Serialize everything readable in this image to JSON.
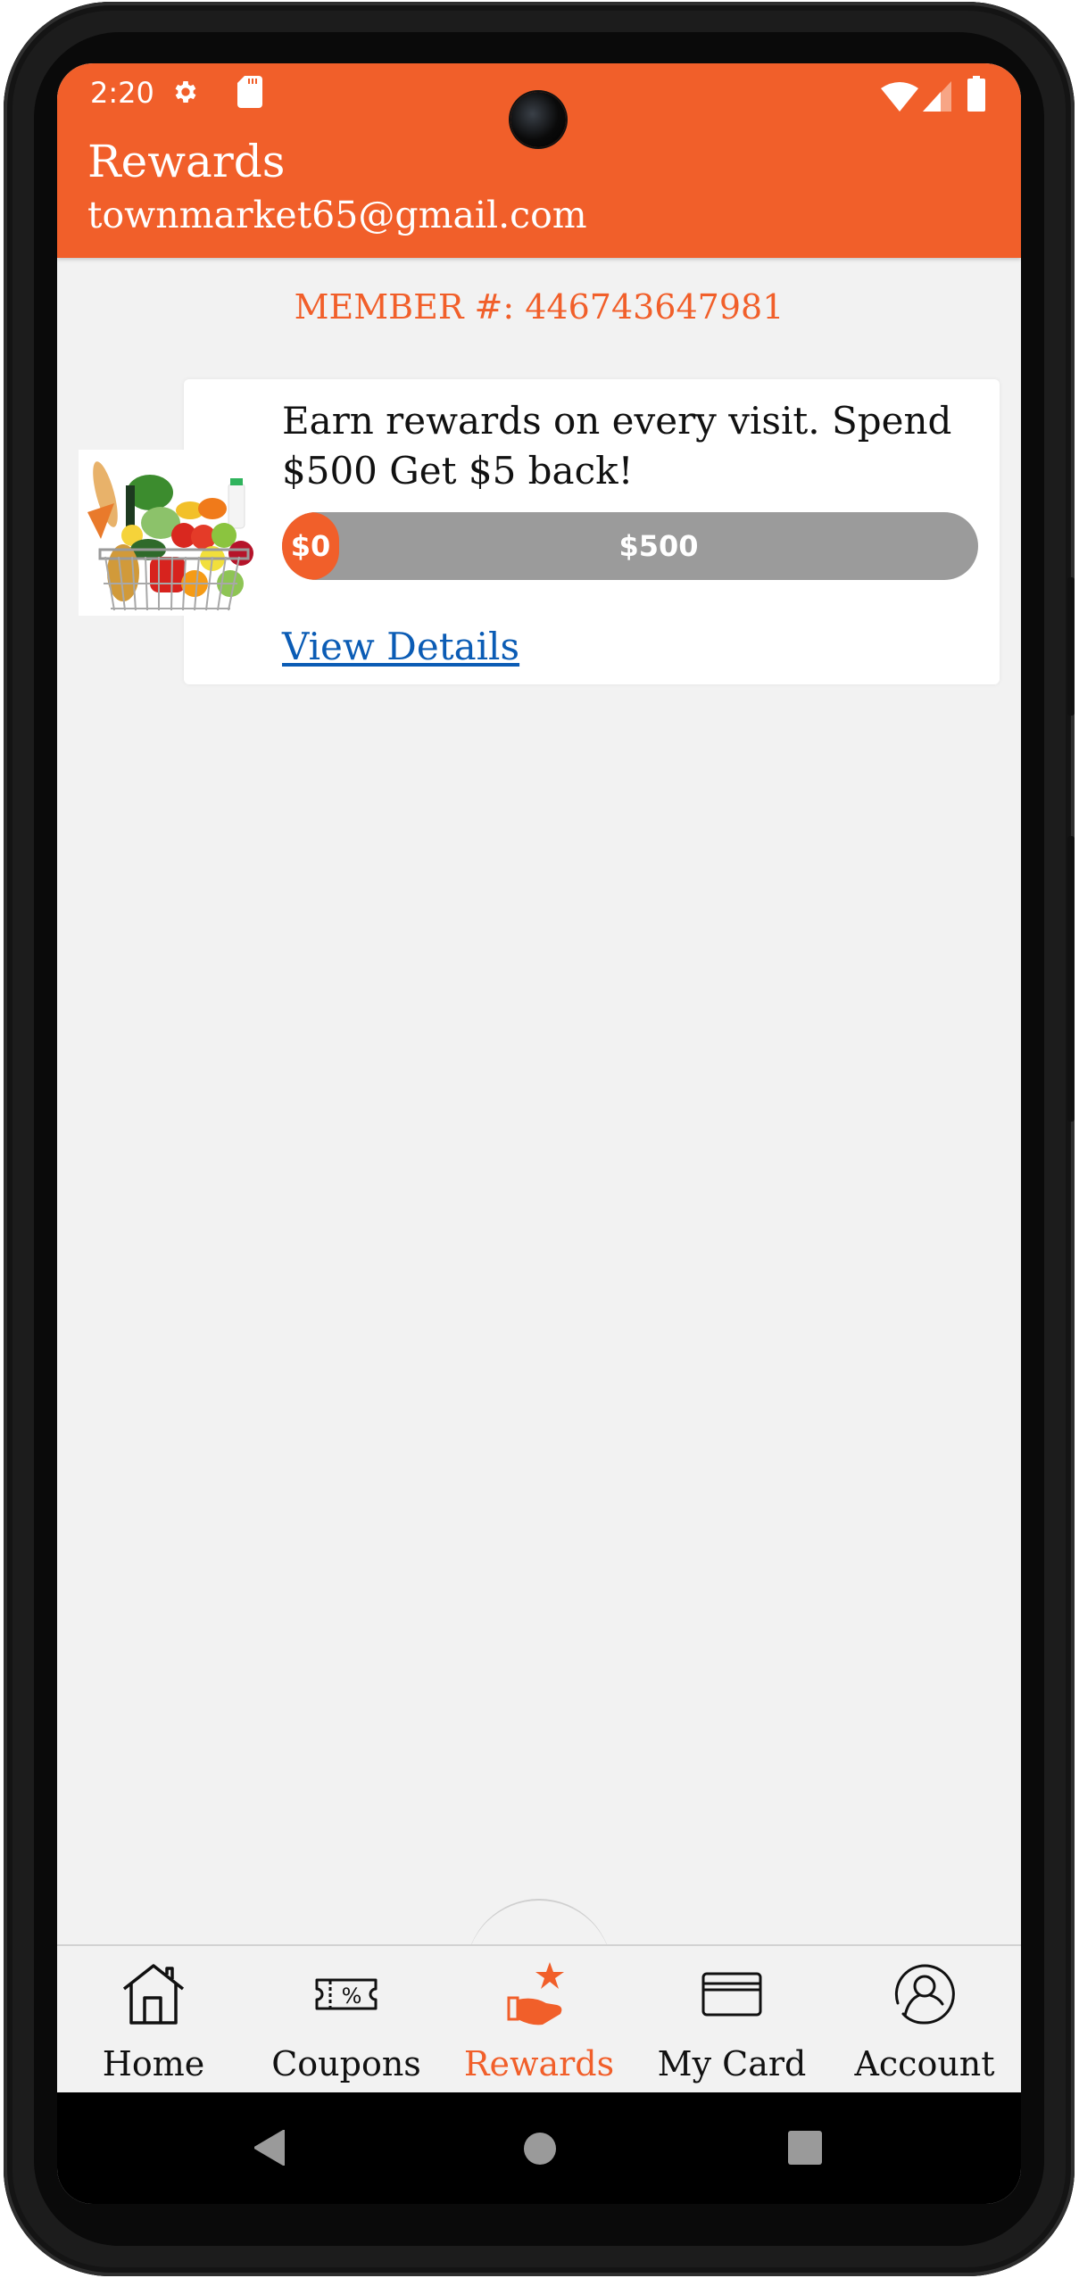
{
  "status_bar": {
    "time": "2:20",
    "left_icons": [
      "gear-icon",
      "sd-card-icon"
    ],
    "right_icons": [
      "wifi-icon",
      "cellular-signal-icon",
      "battery-icon"
    ]
  },
  "app_bar": {
    "title": "Rewards",
    "subtitle": "townmarket65@gmail.com"
  },
  "member": {
    "label": "MEMBER #: 446743647981"
  },
  "reward_card": {
    "image": "grocery-basket-image",
    "description": "Earn rewards on every visit. Spend $500 Get $5 back!",
    "progress": {
      "current_label": "$0",
      "goal_label": "$500",
      "current_value": 0,
      "goal_value": 500
    },
    "link_label": "View Details"
  },
  "bottom_nav": {
    "items": [
      {
        "label": "Home",
        "icon": "home-icon",
        "active": false
      },
      {
        "label": "Coupons",
        "icon": "coupon-icon",
        "active": false
      },
      {
        "label": "Rewards",
        "icon": "rewards-hand-star-icon",
        "active": true
      },
      {
        "label": "My Card",
        "icon": "credit-card-icon",
        "active": false
      },
      {
        "label": "Account",
        "icon": "account-icon",
        "active": false
      }
    ]
  },
  "system_nav": {
    "buttons": [
      "back",
      "home",
      "recents"
    ]
  },
  "colors": {
    "brand": "#f15f2a",
    "link": "#0b5cb5",
    "progress_track": "#9b9b9b",
    "background": "#f2f2f2"
  }
}
